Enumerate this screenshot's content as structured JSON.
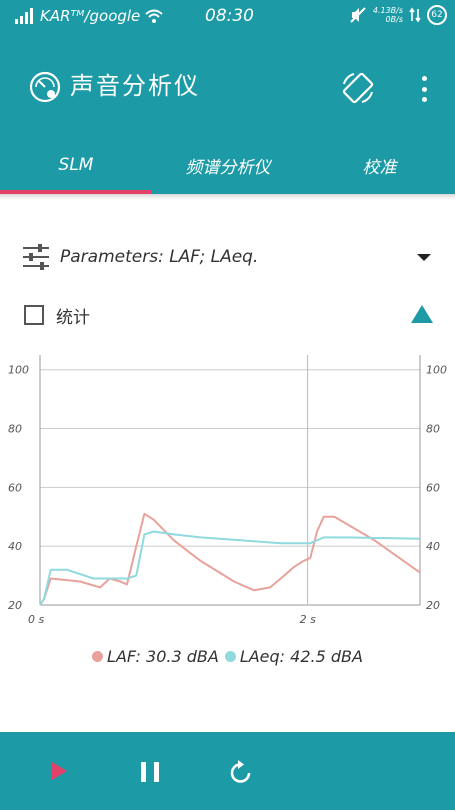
{
  "status": {
    "carrier": "KARᵀᴹ/google",
    "time": "08:30",
    "speed_up": "4.13B/s",
    "speed_down": "0B/s",
    "battery": "62"
  },
  "app": {
    "title": "声音分析仪"
  },
  "tabs": [
    {
      "label": "SLM",
      "active": true
    },
    {
      "label": "频谱分析仪",
      "active": false
    },
    {
      "label": "校准",
      "active": false
    }
  ],
  "params": {
    "label": "Parameters: LAF; LAeq."
  },
  "stats": {
    "label": "统计",
    "checked": false
  },
  "colors": {
    "accent": "#1c9aa6",
    "indicator": "#e2426a",
    "laf": "#e8a29b",
    "laeq": "#8fd9df"
  },
  "chart_data": {
    "type": "line",
    "title": "",
    "xlabel": "",
    "ylabel": "",
    "ylim": [
      20,
      105
    ],
    "xlim": [
      0,
      2.84
    ],
    "x_ticks": [
      {
        "value": 0,
        "label": "0 s"
      },
      {
        "value": 2,
        "label": "2 s"
      }
    ],
    "y_ticks": [
      20,
      40,
      60,
      80,
      100
    ],
    "grid": true,
    "series": [
      {
        "name": "LAF",
        "color": "#e8a29b",
        "x": [
          0,
          0.03,
          0.08,
          0.3,
          0.45,
          0.52,
          0.6,
          0.65,
          0.72,
          0.78,
          0.85,
          1.0,
          1.2,
          1.45,
          1.6,
          1.72,
          1.8,
          1.9,
          1.97,
          2.02,
          2.07,
          2.12,
          2.2,
          2.5,
          2.84
        ],
        "values": [
          20,
          22,
          29,
          28,
          26,
          29,
          28,
          27,
          40,
          51,
          49,
          42,
          35,
          28,
          25,
          26,
          29,
          33,
          35,
          36,
          45,
          50,
          50,
          42,
          31
        ]
      },
      {
        "name": "LAeq",
        "color": "#8fd9df",
        "x": [
          0,
          0.03,
          0.08,
          0.2,
          0.4,
          0.55,
          0.65,
          0.72,
          0.78,
          0.85,
          1.0,
          1.2,
          1.5,
          1.8,
          2.0,
          2.02,
          2.07,
          2.12,
          2.3,
          2.84
        ],
        "values": [
          20,
          22,
          32,
          32,
          29,
          29,
          29,
          30,
          44,
          45,
          44,
          43,
          42,
          41,
          41,
          41,
          42,
          43,
          43,
          42.5
        ]
      }
    ]
  },
  "legend": {
    "laf_label": "LAF: 30.3 dBA",
    "laeq_label": "LAeq: 42.5 dBA"
  }
}
